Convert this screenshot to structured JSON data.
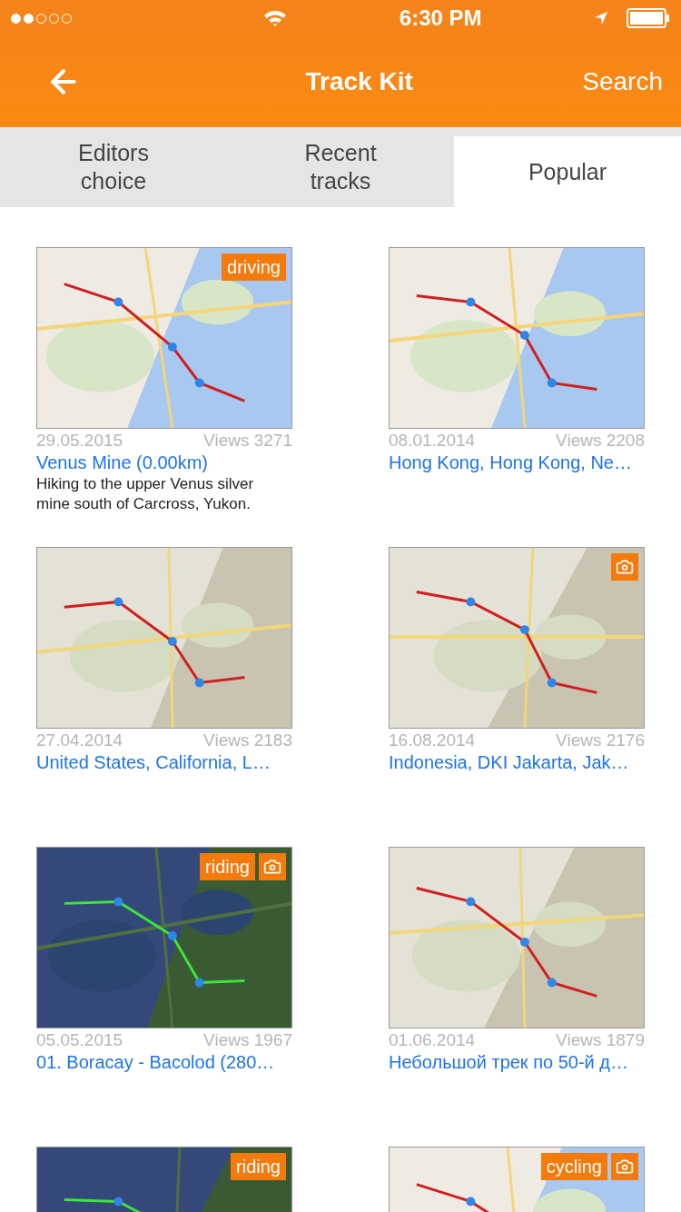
{
  "status_bar": {
    "time": "6:30 PM"
  },
  "nav": {
    "title": "Track Kit",
    "action": "Search"
  },
  "tabs": [
    {
      "label": "Editors choice",
      "selected": false
    },
    {
      "label": "Recent tracks",
      "selected": false
    },
    {
      "label": "Popular",
      "selected": true
    }
  ],
  "tracks": [
    {
      "tag": "driving",
      "photo": false,
      "date": "29.05.2015",
      "views": "Views 3271",
      "title": "Venus Mine (0.00km)",
      "description": "Hiking to the upper Venus silver mine south of Carcross, Yukon."
    },
    {
      "photo": false,
      "date": "08.01.2014",
      "views": "Views 2208",
      "title": "Hong Kong, Hong Kong, Ne…"
    },
    {
      "photo": false,
      "date": "27.04.2014",
      "views": "Views 2183",
      "title": "United States, California, L…"
    },
    {
      "photo": true,
      "date": "16.08.2014",
      "views": "Views 2176",
      "title": "Indonesia, DKI Jakarta, Jak…"
    },
    {
      "tag": "riding",
      "photo": true,
      "date": "05.05.2015",
      "views": "Views 1967",
      "title": "01. Boracay - Bacolod (280…"
    },
    {
      "photo": false,
      "date": "01.06.2014",
      "views": "Views 1879",
      "title": "Небольшой трек по 50-й д…"
    },
    {
      "tag": "riding",
      "photo": false
    },
    {
      "tag": "cycling",
      "photo": true
    }
  ]
}
